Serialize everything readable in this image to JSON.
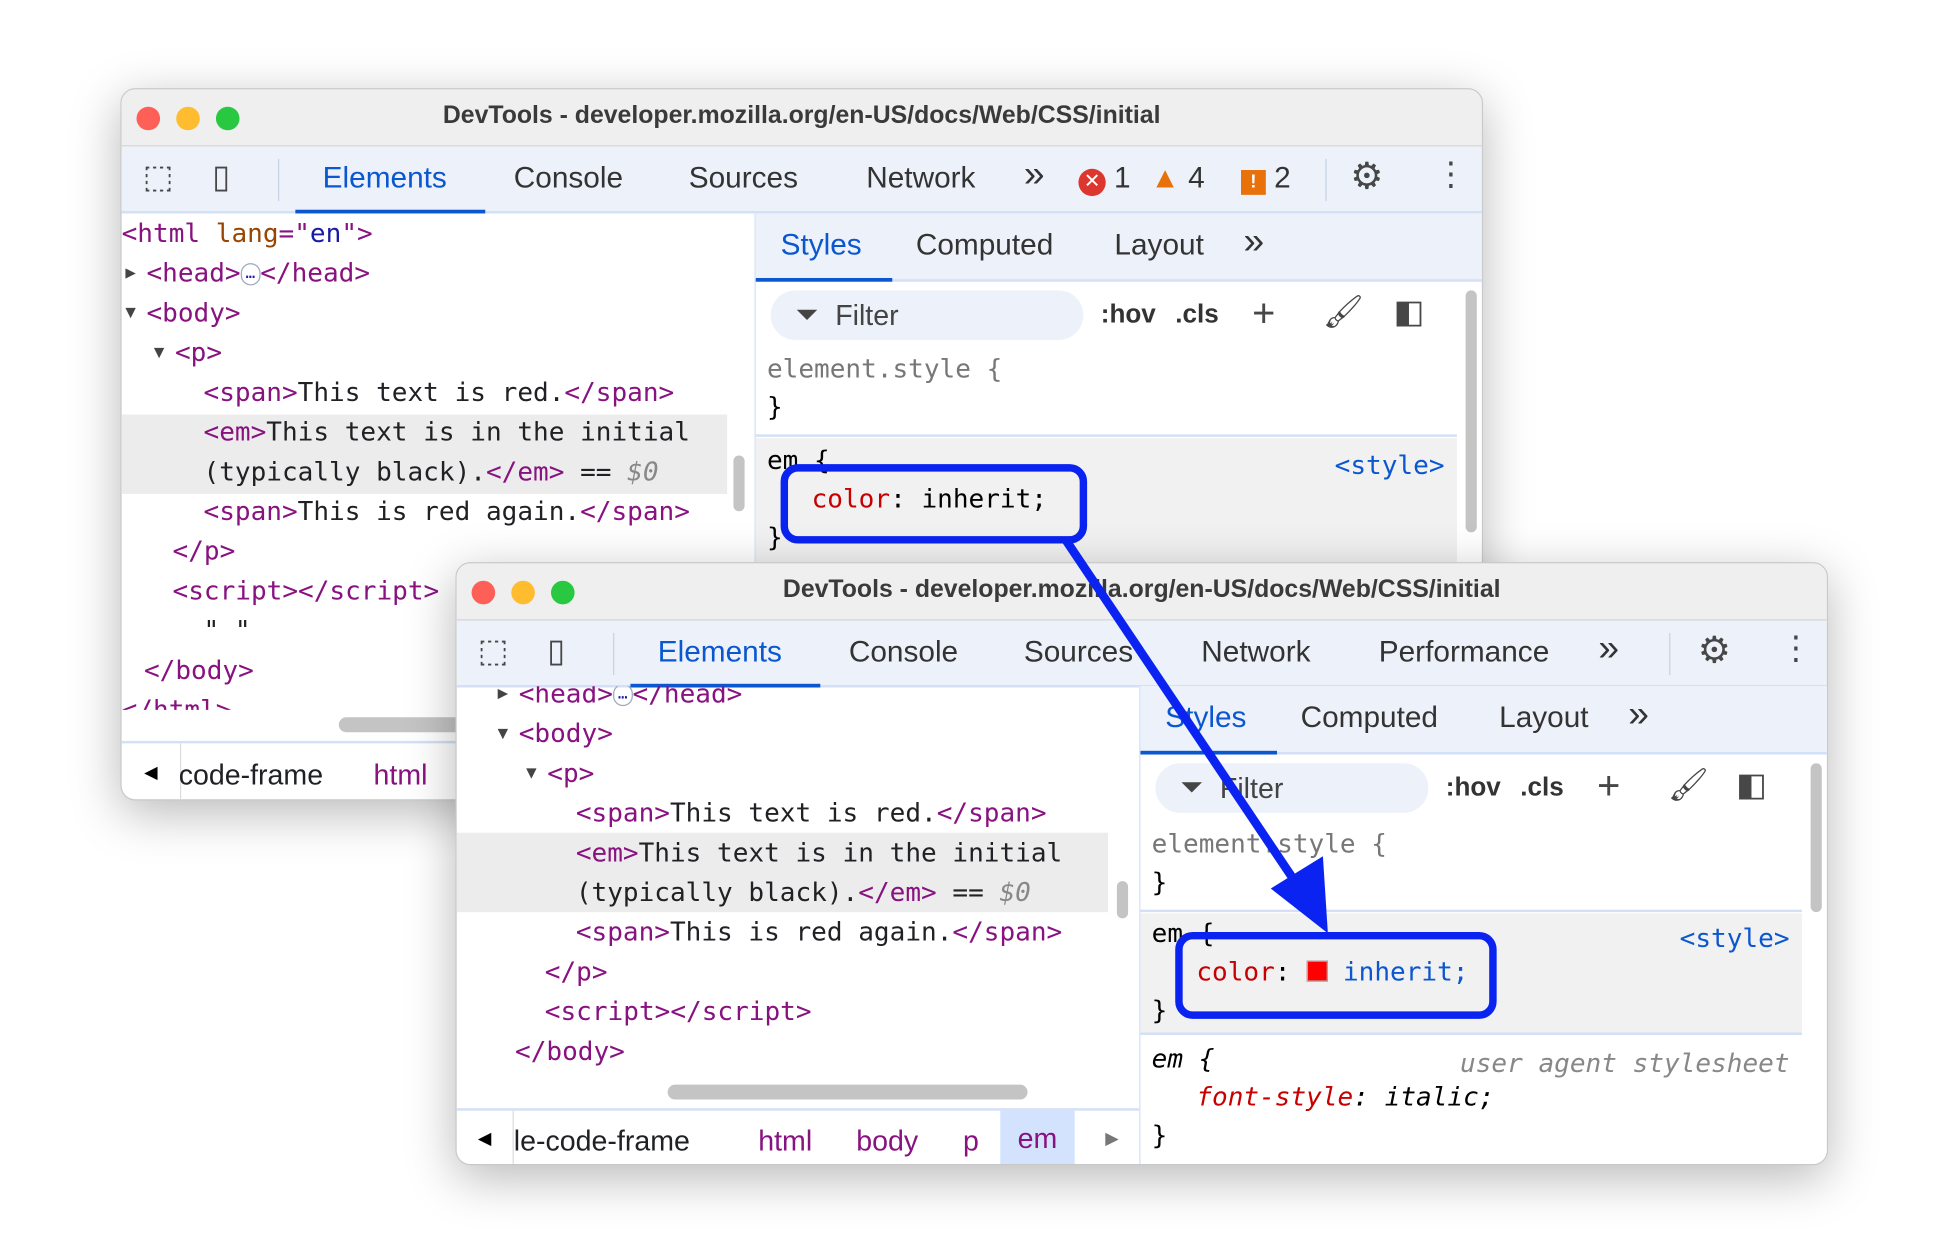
{
  "title": "DevTools - developer.mozilla.org/en-US/docs/Web/CSS/initial",
  "colors": {
    "accent": "#0b57d0",
    "annotation": "#0a23f0",
    "tag": "#881280",
    "swatch": "#ff0000"
  },
  "back": {
    "tabs": [
      "Elements",
      "Console",
      "Sources",
      "Network"
    ],
    "more": "»",
    "errors": "1",
    "warnings": "4",
    "issues": "2",
    "lines": [
      {
        "segs": [
          {
            "k": "tag",
            "v": "<html "
          },
          {
            "k": "an",
            "v": "lang"
          },
          {
            "k": "tag",
            "v": "=\""
          },
          {
            "k": "av",
            "v": "en"
          },
          {
            "k": "tag",
            "v": "\">"
          }
        ]
      },
      {
        "tri": "▶",
        "segs": [
          {
            "k": "tag",
            "v": "<head>"
          },
          {
            "k": "ell",
            "v": "…"
          },
          {
            "k": "tag",
            "v": "</head>"
          }
        ]
      },
      {
        "tri": "▼",
        "segs": [
          {
            "k": "tag",
            "v": "<body>"
          }
        ]
      },
      {
        "tri": "▼",
        "segs": [
          {
            "k": "tag",
            "v": "<p>"
          }
        ]
      },
      {
        "segs": [
          {
            "k": "tag",
            "v": "<span>"
          },
          {
            "k": "tx",
            "v": "This text is red."
          },
          {
            "k": "tag",
            "v": "</span>"
          }
        ]
      },
      {
        "segs": [
          {
            "k": "tag",
            "v": "<em>"
          },
          {
            "k": "tx",
            "v": "This text is in the initial"
          }
        ]
      },
      {
        "segs": [
          {
            "k": "tx",
            "v": "(typically black)."
          },
          {
            "k": "tag",
            "v": "</em>"
          },
          {
            "k": "tx",
            "v": " == "
          },
          {
            "k": "dim",
            "v": "$0"
          }
        ]
      },
      {
        "segs": [
          {
            "k": "tag",
            "v": "<span>"
          },
          {
            "k": "tx",
            "v": "This is red again."
          },
          {
            "k": "tag",
            "v": "</span>"
          }
        ]
      },
      {
        "segs": [
          {
            "k": "tag",
            "v": "</p>"
          }
        ]
      },
      {
        "segs": [
          {
            "k": "tag",
            "v": "<script></script>"
          }
        ]
      },
      {
        "segs": [
          {
            "k": "tx",
            "v": "\" \""
          }
        ]
      },
      {
        "segs": [
          {
            "k": "tag",
            "v": "</body>"
          }
        ]
      },
      {
        "segs": [
          {
            "k": "tag",
            "v": "</html>"
          }
        ]
      }
    ],
    "styles_tabs": [
      "Styles",
      "Computed",
      "Layout"
    ],
    "filter": "Filter",
    "hov": ":hov",
    "cls": ".cls",
    "element_style": "element.style {",
    "close": "}",
    "em_sel": "em {",
    "em_src": "<style>",
    "prop": "color",
    "val": "inherit;",
    "crumbs": [
      "code-frame",
      "html"
    ]
  },
  "front": {
    "tabs": [
      "Elements",
      "Console",
      "Sources",
      "Network",
      "Performance"
    ],
    "more": "»",
    "lines": [
      {
        "tri": "▶",
        "segs": [
          {
            "k": "tag",
            "v": "<head>"
          },
          {
            "k": "ell",
            "v": "…"
          },
          {
            "k": "tag",
            "v": "</head>"
          }
        ]
      },
      {
        "tri": "▼",
        "segs": [
          {
            "k": "tag",
            "v": "<body>"
          }
        ]
      },
      {
        "tri": "▼",
        "segs": [
          {
            "k": "tag",
            "v": "<p>"
          }
        ]
      },
      {
        "segs": [
          {
            "k": "tag",
            "v": "<span>"
          },
          {
            "k": "tx",
            "v": "This text is red."
          },
          {
            "k": "tag",
            "v": "</span>"
          }
        ]
      },
      {
        "segs": [
          {
            "k": "tag",
            "v": "<em>"
          },
          {
            "k": "tx",
            "v": "This text is in the initial"
          }
        ]
      },
      {
        "segs": [
          {
            "k": "tx",
            "v": "(typically black)."
          },
          {
            "k": "tag",
            "v": "</em>"
          },
          {
            "k": "tx",
            "v": " == "
          },
          {
            "k": "dim",
            "v": "$0"
          }
        ]
      },
      {
        "segs": [
          {
            "k": "tag",
            "v": "<span>"
          },
          {
            "k": "tx",
            "v": "This is red again."
          },
          {
            "k": "tag",
            "v": "</span>"
          }
        ]
      },
      {
        "segs": [
          {
            "k": "tag",
            "v": "</p>"
          }
        ]
      },
      {
        "segs": [
          {
            "k": "tag",
            "v": "<script></script>"
          }
        ]
      },
      {
        "segs": [
          {
            "k": "tag",
            "v": "</body>"
          }
        ]
      }
    ],
    "styles_tabs": [
      "Styles",
      "Computed",
      "Layout"
    ],
    "filter": "Filter",
    "hov": ":hov",
    "cls": ".cls",
    "element_style": "element.style {",
    "close": "}",
    "em_sel": "em {",
    "em_src": "<style>",
    "prop": "color",
    "val": "inherit;",
    "ua_sel": "em {",
    "ua_src": "user agent stylesheet",
    "ua_prop": "font-style",
    "ua_val": "italic;",
    "crumbs": [
      "le-code-frame",
      "html",
      "body",
      "p",
      "em"
    ]
  }
}
